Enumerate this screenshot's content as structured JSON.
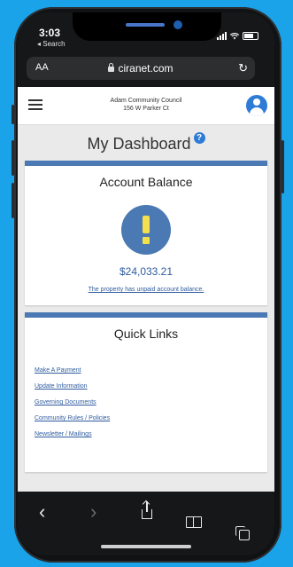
{
  "status_bar": {
    "time": "3:03",
    "back_label": "◂ Search"
  },
  "url_bar": {
    "text_size": "AA",
    "domain": "ciranet.com"
  },
  "header": {
    "org_name": "Adam Community Council",
    "address": "156 W Parker Ct"
  },
  "page": {
    "title": "My Dashboard",
    "help_glyph": "?"
  },
  "account": {
    "title": "Account Balance",
    "amount": "$24,033.21",
    "notice": "The property has unpaid account balance."
  },
  "quick_links": {
    "title": "Quick Links",
    "items": [
      {
        "label": "Make A Payment"
      },
      {
        "label": "Update Information"
      },
      {
        "label": "Governing Documents"
      },
      {
        "label": "Community Rules / Policies"
      },
      {
        "label": "Newsletter / Mailings"
      }
    ]
  },
  "toolbar": {
    "back_glyph": "‹",
    "forward_glyph": "›"
  },
  "colors": {
    "accent": "#4a79b3",
    "link": "#2f5c9e",
    "alert": "#f4df4c",
    "background": "#1aa3e8"
  },
  "icons": [
    "menu-icon",
    "user-avatar-icon",
    "help-icon",
    "exclamation-icon",
    "share-icon",
    "bookmarks-icon",
    "tabs-icon",
    "lock-icon",
    "reload-icon"
  ]
}
